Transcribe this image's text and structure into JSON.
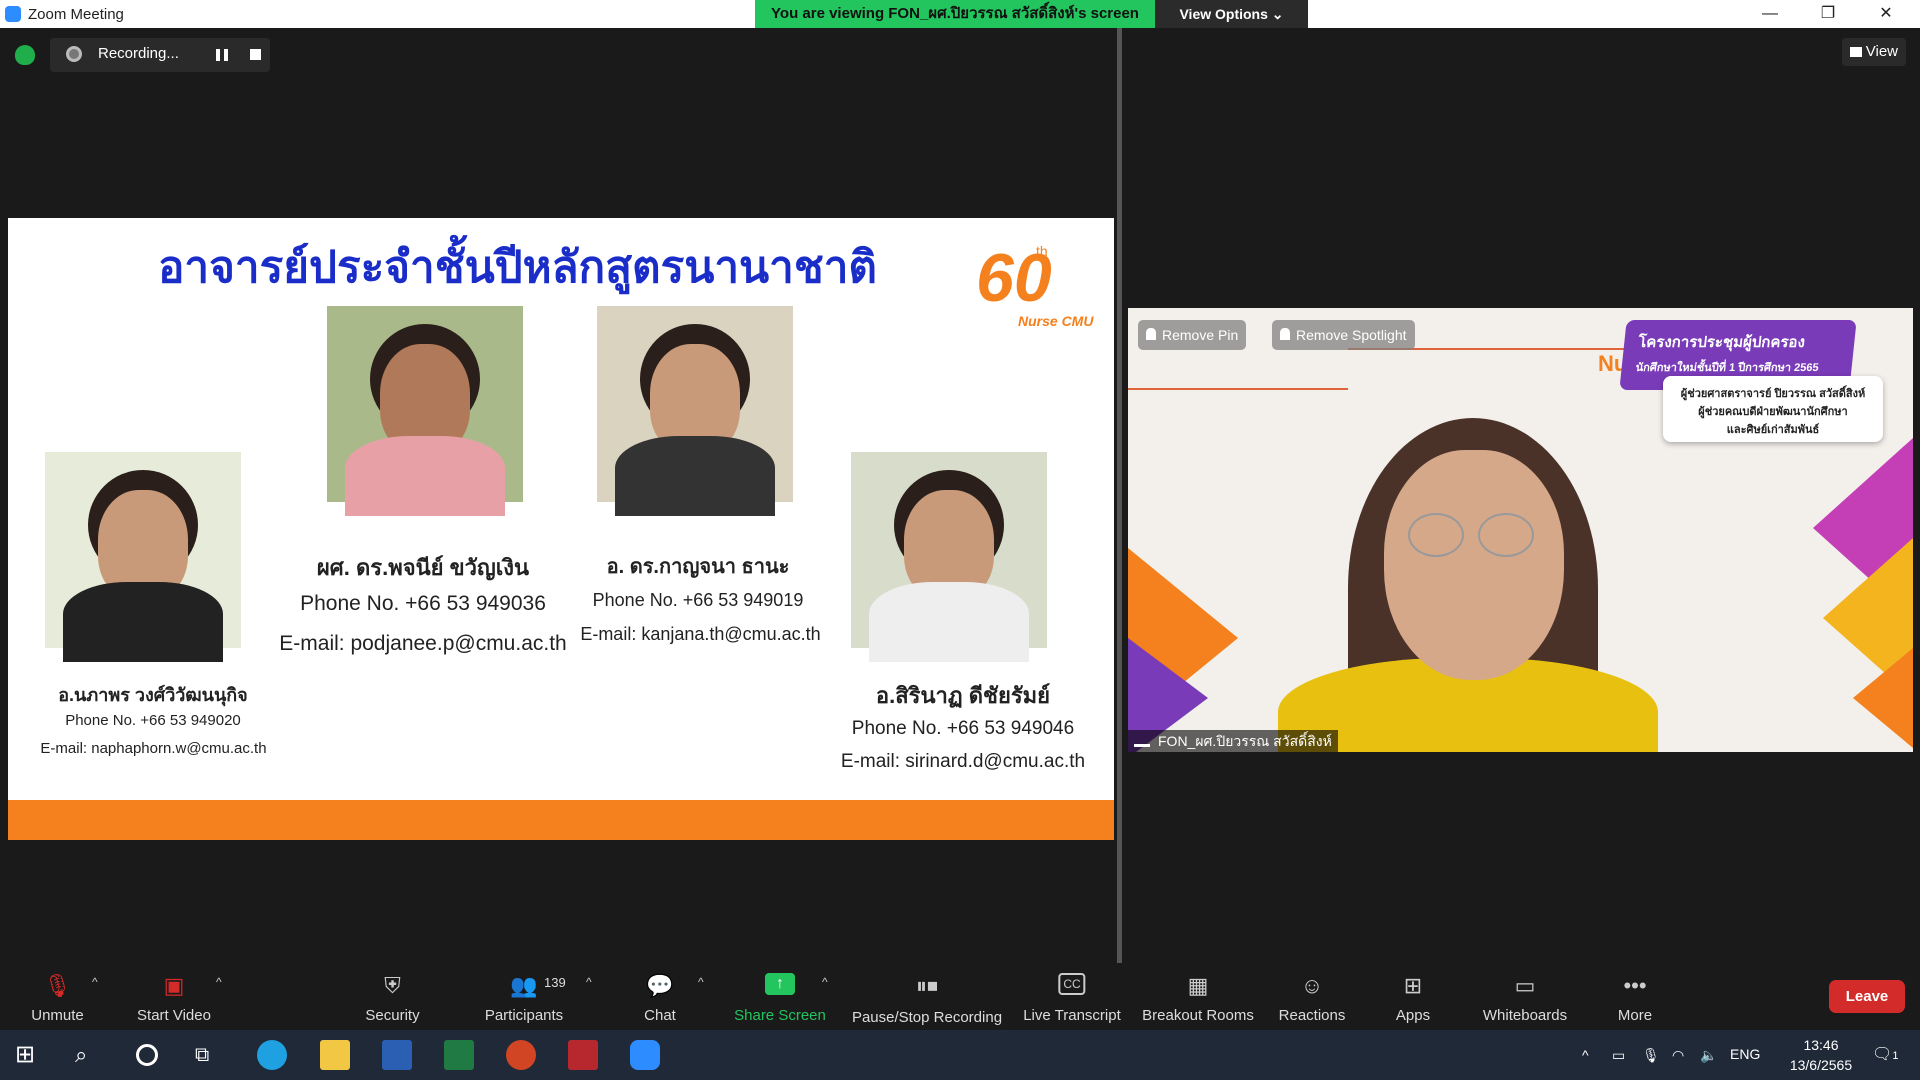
{
  "window": {
    "title": "Zoom Meeting",
    "viewing_banner": "You are viewing FON_ผศ.ปิยวรรณ สวัสดิ์สิงห์'s screen",
    "view_options": "View Options",
    "view_button": "View"
  },
  "recording": {
    "label": "Recording..."
  },
  "slide": {
    "title": "อาจารย์ประจำชั้นปีหลักสูตรนานาชาติ",
    "logo": {
      "number": "60",
      "suffix": "th",
      "brand": "Nurse CMU"
    },
    "people": [
      {
        "name": "อ.นภาพร วงศ์วิวัฒนนุกิจ",
        "phone": "Phone No.  +66 53 949020",
        "email": "E-mail: naphaphorn.w@cmu.ac.th"
      },
      {
        "name": "ผศ. ดร.พจนีย์ ขวัญเงิน",
        "phone": "Phone No. +66 53 949036",
        "email": "E-mail: podjanee.p@cmu.ac.th"
      },
      {
        "name": "อ. ดร.กาญจนา ธานะ",
        "phone": "Phone No.  +66 53 949019",
        "email": "E-mail: kanjana.th@cmu.ac.th"
      },
      {
        "name": "อ.สิรินาฏ ดีชัยรัมย์",
        "phone": "Phone No. +66 53 949046",
        "email": "E-mail: sirinard.d@cmu.ac.th"
      }
    ]
  },
  "video": {
    "remove_pin": "Remove Pin",
    "remove_spotlight": "Remove Spotlight",
    "banner_title": "โครงการประชุมผู้ปกครอง",
    "banner_sub": "นักศึกษาใหม่ชั้นปีที่ 1 ปีการศึกษา 2565",
    "card_line1": "ผู้ช่วยศาสตราจารย์ ปิยวรรณ สวัสดิ์สิงห์",
    "card_line2": "ผู้ช่วยคณบดีฝ่ายพัฒนานักศึกษา",
    "card_line3": "และศิษย์เก่าสัมพันธ์",
    "brand": "NurseCMU",
    "participant_name": "FON_ผศ.ปิยวรรณ สวัสดิ์สิงห์"
  },
  "toolbar": {
    "unmute": "Unmute",
    "start_video": "Start Video",
    "security": "Security",
    "participants": "Participants",
    "participants_count": "139",
    "chat": "Chat",
    "share_screen": "Share Screen",
    "pause_stop": "Pause/Stop Recording",
    "live_transcript": "Live Transcript",
    "breakout": "Breakout Rooms",
    "reactions": "Reactions",
    "apps": "Apps",
    "whiteboards": "Whiteboards",
    "more": "More",
    "leave": "Leave"
  },
  "taskbar": {
    "lang": "ENG",
    "time": "13:46",
    "date": "13/6/2565",
    "notifications": "1"
  },
  "colors": {
    "accent_green": "#23c55e",
    "slide_title": "#1a2dc8",
    "orange": "#f4801e",
    "leave": "#d32a2a"
  }
}
